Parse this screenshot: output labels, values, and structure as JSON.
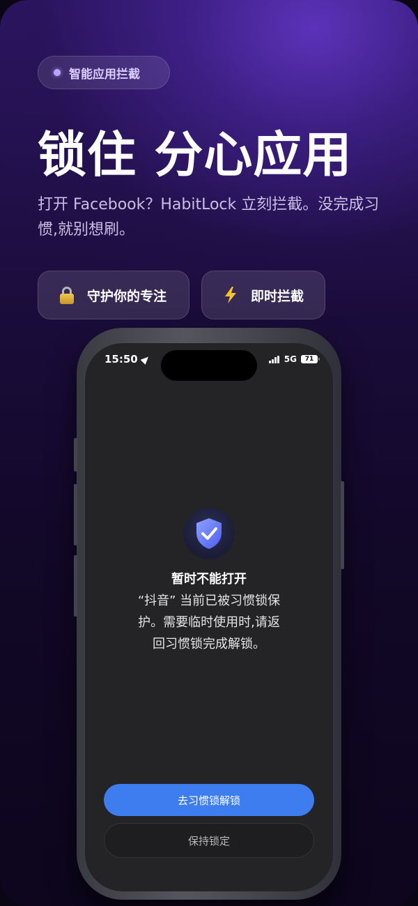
{
  "tag": {
    "label": "智能应用拦截"
  },
  "headline": "锁住 分心应用",
  "subtitle": "打开 Facebook？HabitLock 立刻拦截。没完成习惯,就别想刷。",
  "features": [
    {
      "icon": "lock-icon",
      "label": "守护你的专注"
    },
    {
      "icon": "lightning-icon",
      "label": "即时拦截"
    }
  ],
  "phone": {
    "status_bar": {
      "time": "15:50",
      "network": "5G",
      "battery": "71"
    },
    "block_screen": {
      "icon": "shield-check-icon",
      "title": "暂时不能打开",
      "message": "“抖音” 当前已被习惯锁保护。需要临时使用时,请返回习惯锁完成解锁。",
      "primary_button": "去习惯锁解锁",
      "secondary_button": "保持锁定"
    }
  },
  "colors": {
    "accent": "#3d7df0",
    "background_top": "#2c1560",
    "background_bottom": "#0d061d"
  }
}
